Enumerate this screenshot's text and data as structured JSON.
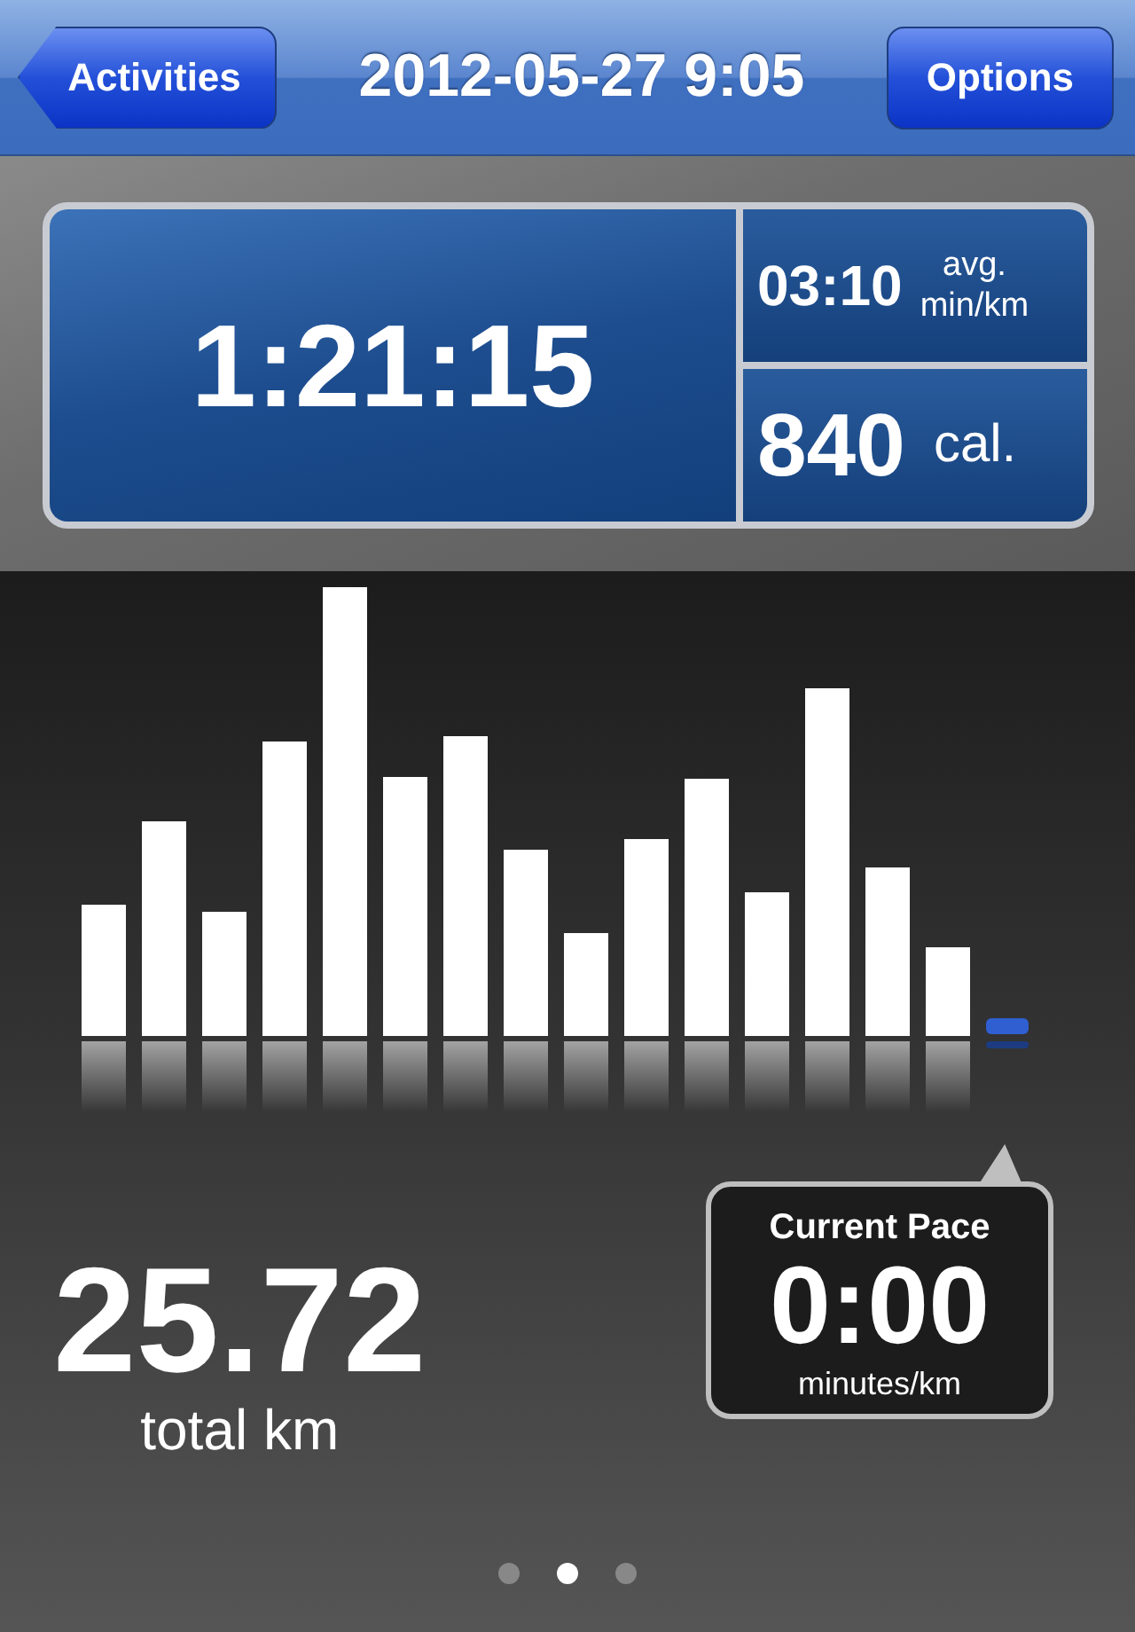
{
  "nav": {
    "back_label": "Activities",
    "title": "2012-05-27 9:05",
    "options_label": "Options"
  },
  "stats": {
    "duration": "1:21:15",
    "pace_value": "03:10",
    "pace_unit_top": "avg.",
    "pace_unit_bottom": "min/km",
    "calories_value": "840",
    "calories_unit": "cal."
  },
  "distance": {
    "value": "25.72",
    "label": "total km"
  },
  "current_pace": {
    "title": "Current Pace",
    "value": "0:00",
    "unit": "minutes/km"
  },
  "page_dots": [
    {
      "selected": false
    },
    {
      "selected": true
    },
    {
      "selected": false
    }
  ]
}
